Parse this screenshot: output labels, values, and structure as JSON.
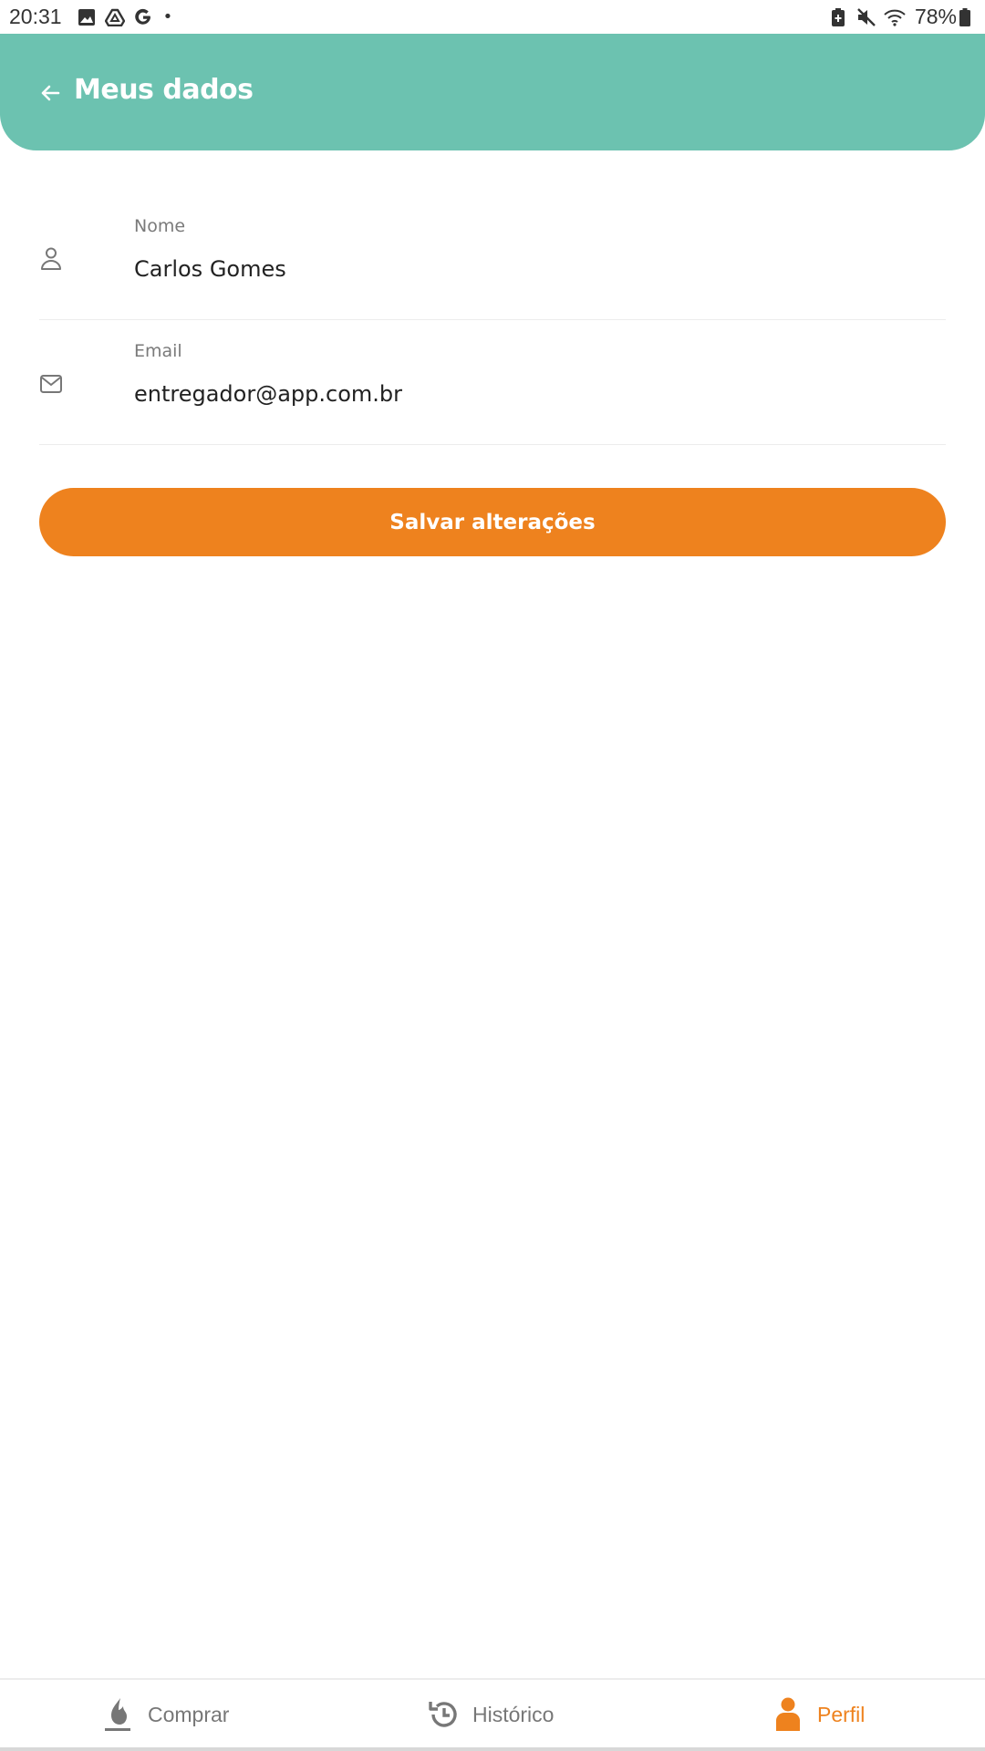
{
  "status_bar": {
    "time": "20:31",
    "battery_text": "78%",
    "left_icons": [
      "image-icon",
      "drive-icon",
      "google-icon",
      "dot"
    ],
    "right_icons": [
      "battery-saver-icon",
      "mute-icon",
      "wifi-icon",
      "battery-icon"
    ]
  },
  "header": {
    "title": "Meus dados",
    "background_color": "#6cc2b0",
    "back_icon": "arrow-left-icon"
  },
  "form": {
    "fields": [
      {
        "label": "Nome",
        "value": "Carlos Gomes",
        "icon": "user-icon"
      },
      {
        "label": "Email",
        "value": "entregador@app.com.br",
        "icon": "mail-icon"
      }
    ],
    "save_label": "Salvar alterações",
    "save_color": "#ee821e"
  },
  "bottom_nav": {
    "items": [
      {
        "label": "Comprar",
        "icon": "flame-icon",
        "active": false
      },
      {
        "label": "Histórico",
        "icon": "history-icon",
        "active": false
      },
      {
        "label": "Perfil",
        "icon": "person-icon",
        "active": true
      }
    ],
    "active_color": "#ee821e"
  }
}
